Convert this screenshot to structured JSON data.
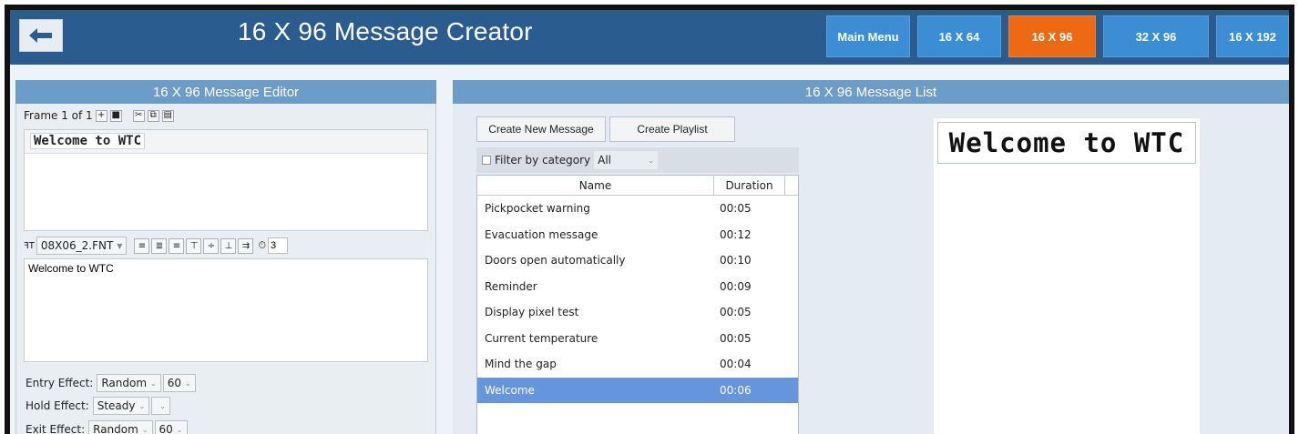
{
  "header": {
    "title": "16 X 96 Message Creator",
    "nav": [
      "Main Menu",
      "16 X 64",
      "16 X 96",
      "32 X 96",
      "16 X 192"
    ],
    "active_nav": "16 X 96",
    "colors": {
      "header_bg": "#2a5c8f",
      "nav_bg": "#3b8ed4",
      "nav_active": "#ee6a12"
    }
  },
  "editor": {
    "title": "16 X 96 Message Editor",
    "frame_label": "Frame 1 of 1",
    "preview_text": "Welcome to WTC",
    "font_select": "08X06_2.FNT",
    "spacing_value": "3",
    "text_value": "Welcome to WTC",
    "entry": {
      "label": "Entry Effect:",
      "effect": "Random",
      "speed": "60"
    },
    "hold": {
      "label": "Hold Effect:",
      "effect": "Steady",
      "speed": ""
    },
    "exit": {
      "label": "Exit Effect:",
      "effect": "Random",
      "speed": "60"
    }
  },
  "list": {
    "title": "16 X 96 Message List",
    "create_message": "Create New Message",
    "create_playlist": "Create Playlist",
    "filter_label": "Filter by category",
    "filter_value": "All",
    "columns": [
      "Name",
      "Duration"
    ],
    "rows": [
      {
        "name": "Pickpocket warning",
        "duration": "00:05"
      },
      {
        "name": "Evacuation message",
        "duration": "00:12"
      },
      {
        "name": "Doors open automatically",
        "duration": "00:10"
      },
      {
        "name": "Reminder",
        "duration": "00:09"
      },
      {
        "name": "Display pixel test",
        "duration": "00:05"
      },
      {
        "name": "Current temperature",
        "duration": "00:05"
      },
      {
        "name": "Mind the gap",
        "duration": "00:04"
      },
      {
        "name": "Welcome",
        "duration": "00:06"
      }
    ],
    "selected_index": 7,
    "preview_text": "Welcome to WTC"
  }
}
